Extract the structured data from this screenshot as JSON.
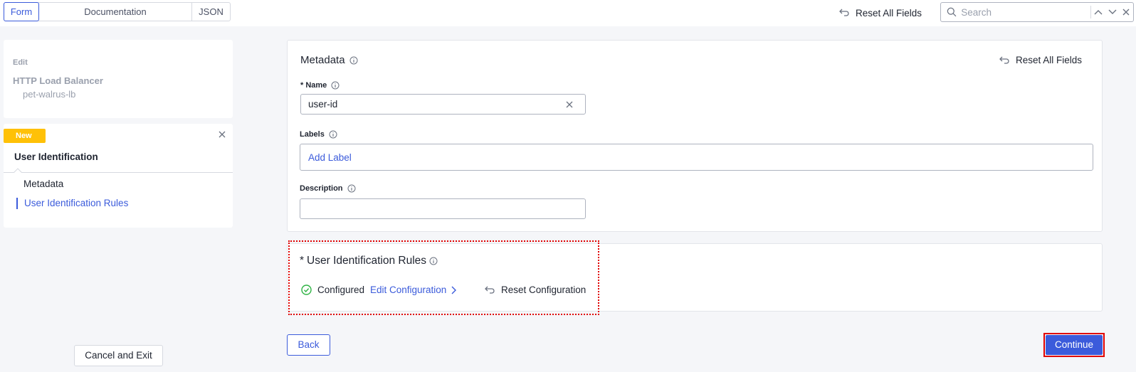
{
  "topbar": {
    "tabs": [
      {
        "label": "Form",
        "active": true
      },
      {
        "label": "Documentation",
        "active": false
      },
      {
        "label": "JSON",
        "active": false
      }
    ],
    "reset_all_label": "Reset All Fields",
    "search": {
      "placeholder": "Search",
      "value": ""
    }
  },
  "sidebar": {
    "edit": {
      "label": "Edit",
      "object_type": "HTTP Load Balancer",
      "object_name": "pet-walrus-lb"
    },
    "new": {
      "badge": "New",
      "title": "User Identification",
      "items": [
        {
          "label": "Metadata",
          "active": false
        },
        {
          "label": "User Identification Rules",
          "active": true
        }
      ]
    },
    "cancel_label": "Cancel and Exit"
  },
  "metadata": {
    "title": "Metadata",
    "reset_label": "Reset All Fields",
    "name": {
      "label": "Name",
      "required_marker": "*",
      "value": "user-id"
    },
    "labels": {
      "label": "Labels",
      "placeholder": "Add Label"
    },
    "description": {
      "label": "Description",
      "value": ""
    }
  },
  "rules": {
    "required_marker": "*",
    "title": "User Identification Rules",
    "status": "Configured",
    "edit_label": "Edit Configuration",
    "reset_label": "Reset Configuration"
  },
  "footer": {
    "back_label": "Back",
    "continue_label": "Continue"
  },
  "colors": {
    "accent": "#3b5bdb",
    "badge": "#ffc107",
    "success": "#2fb344",
    "highlight": "#e00000"
  }
}
